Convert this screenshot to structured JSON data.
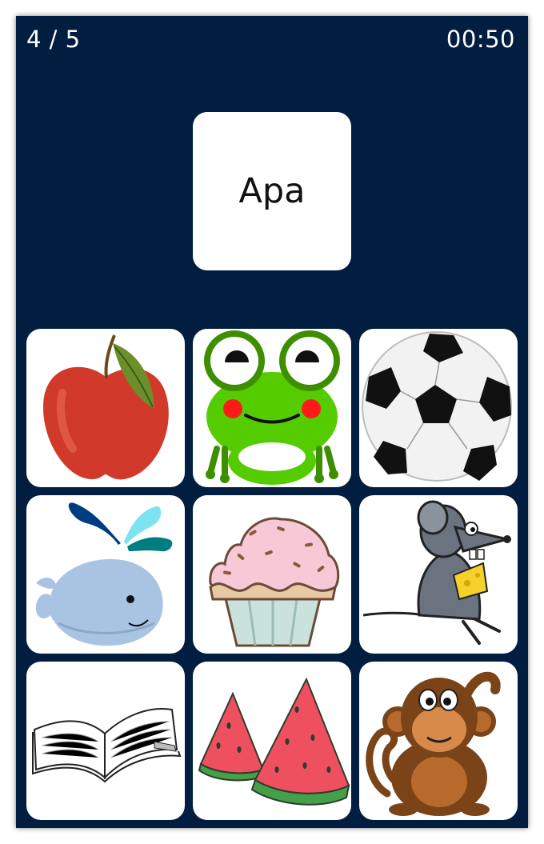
{
  "hud": {
    "progress": "4 / 5",
    "timer": "00:50"
  },
  "prompt": {
    "word": "Apa"
  },
  "choices": [
    {
      "icon": "apple"
    },
    {
      "icon": "frog"
    },
    {
      "icon": "soccer-ball"
    },
    {
      "icon": "whale"
    },
    {
      "icon": "cupcake"
    },
    {
      "icon": "mouse-with-cheese"
    },
    {
      "icon": "open-book"
    },
    {
      "icon": "watermelon"
    },
    {
      "icon": "monkey"
    }
  ],
  "colors": {
    "background": "#011d40",
    "card": "#ffffff",
    "text": "#ffffff"
  }
}
